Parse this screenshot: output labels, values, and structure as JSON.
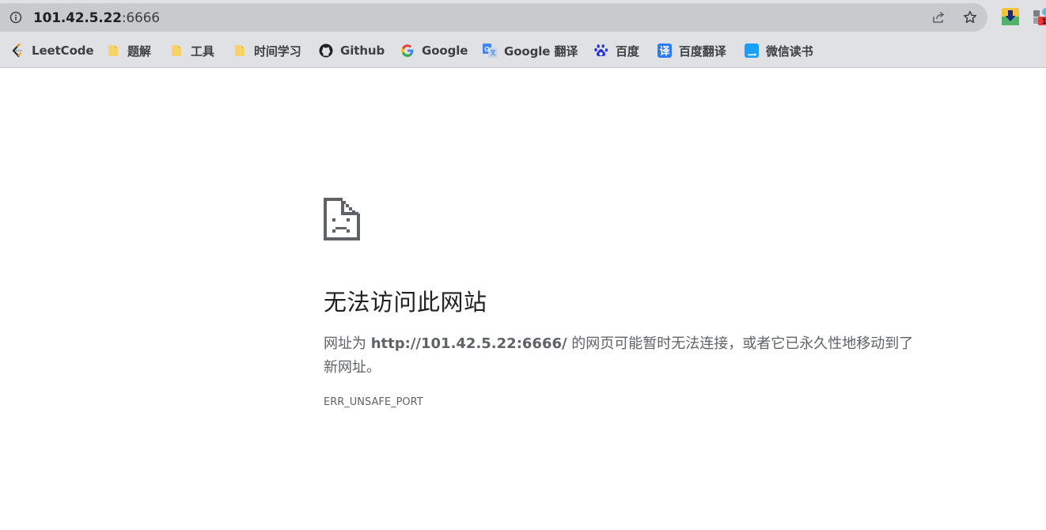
{
  "address_bar": {
    "host": "101.42.5.22",
    "port": ":6666"
  },
  "bookmarks": [
    {
      "label": "LeetCode",
      "icon": "leetcode-icon"
    },
    {
      "label": "题解",
      "icon": "folder-icon"
    },
    {
      "label": "工具",
      "icon": "folder-icon"
    },
    {
      "label": "时间学习",
      "icon": "folder-icon"
    },
    {
      "label": "Github",
      "icon": "github-icon"
    },
    {
      "label": "Google",
      "icon": "google-icon"
    },
    {
      "label": "Google 翻译",
      "icon": "google-translate-icon"
    },
    {
      "label": "百度",
      "icon": "baidu-icon"
    },
    {
      "label": "百度翻译",
      "icon": "baidu-translate-icon"
    },
    {
      "label": "微信读书",
      "icon": "weread-icon"
    }
  ],
  "icons": {
    "translate_glyph": "译",
    "extension_badge": "1"
  },
  "error": {
    "title": "无法访问此网站",
    "desc_prefix": "网址为 ",
    "desc_url": "http://101.42.5.22:6666/",
    "desc_suffix": " 的网页可能暂时无法连接，或者它已永久性地移动到了新网址。",
    "code": "ERR_UNSAFE_PORT"
  },
  "colors": {
    "chrome_bg": "#dfe1e5",
    "omnibox_bg": "#c8cacd",
    "folder_yellow": "#f6d465",
    "text_secondary": "#5f6368"
  }
}
